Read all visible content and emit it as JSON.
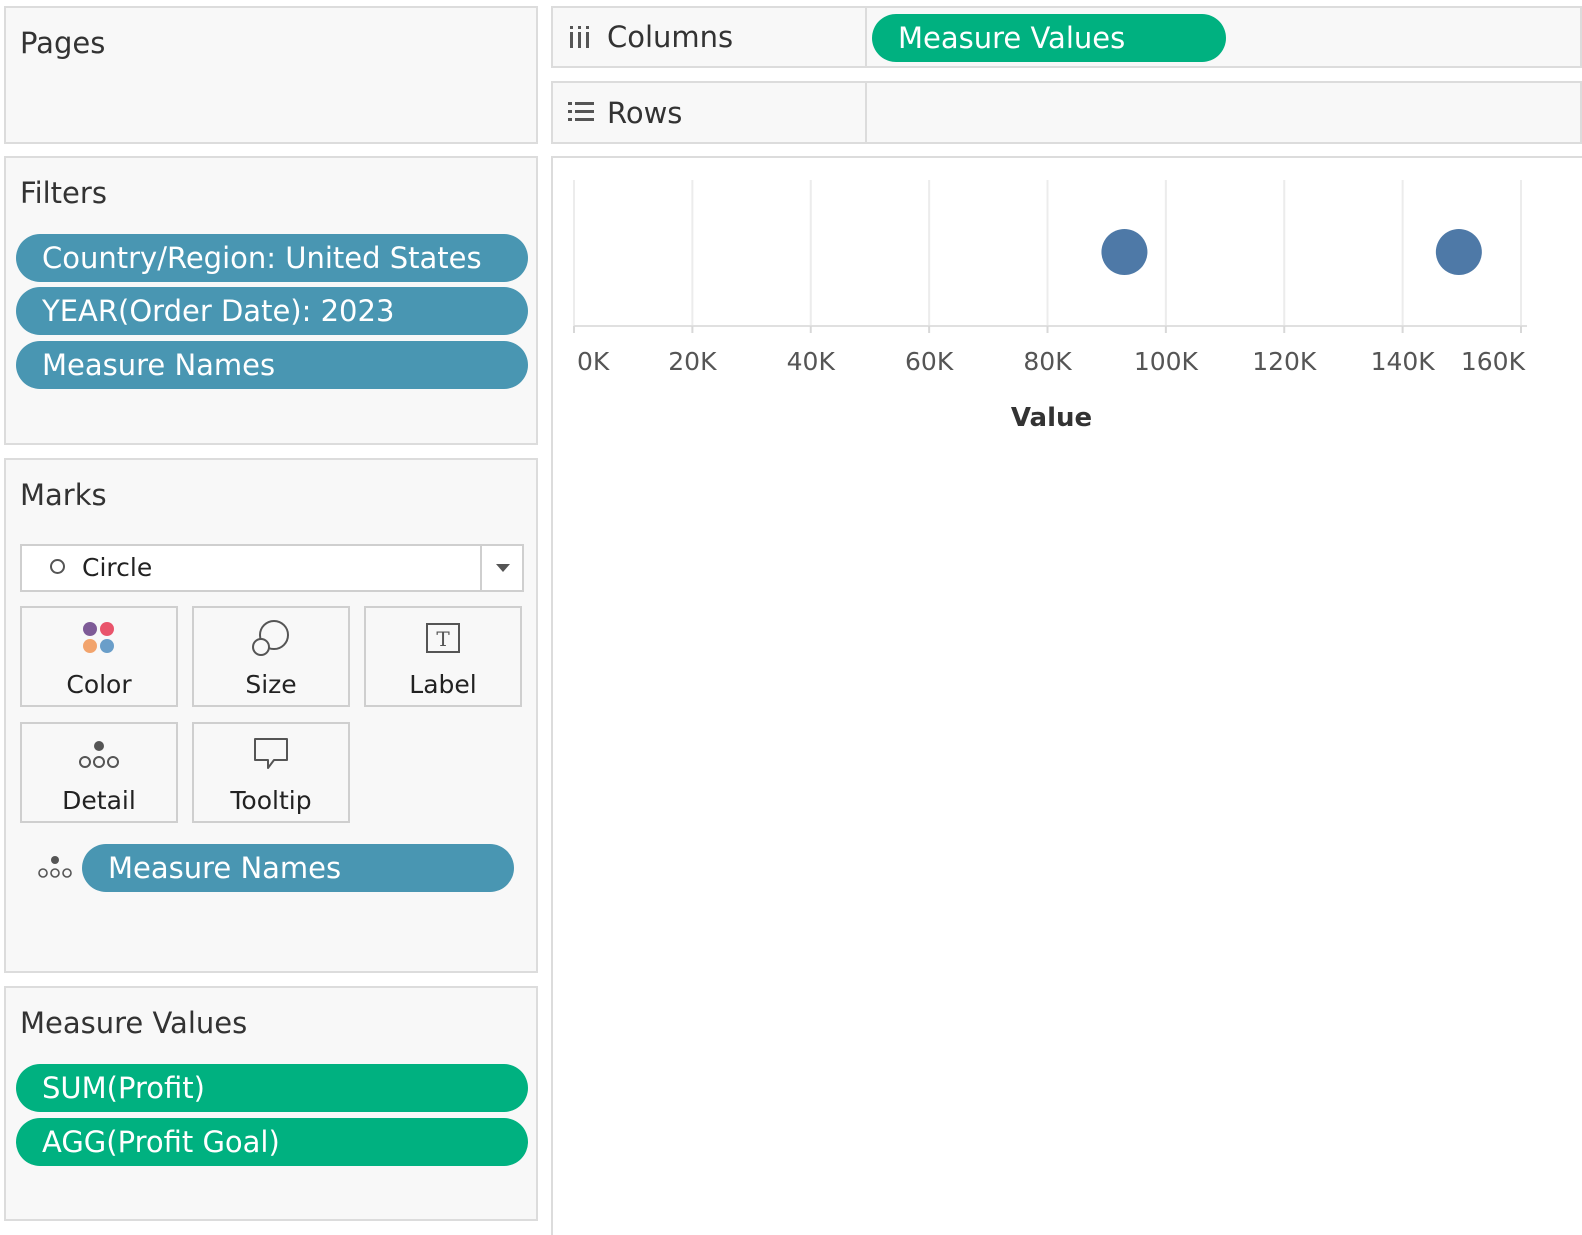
{
  "pages_panel": {
    "title": "Pages"
  },
  "filters_panel": {
    "title": "Filters",
    "pills": [
      {
        "label": "Country/Region: United States"
      },
      {
        "label": "YEAR(Order Date): 2023"
      },
      {
        "label": "Measure Names"
      }
    ]
  },
  "marks_panel": {
    "title": "Marks",
    "mark_type": "Circle",
    "buttons": {
      "color": "Color",
      "size": "Size",
      "label": "Label",
      "detail": "Detail",
      "tooltip": "Tooltip"
    },
    "detail_pill": "Measure Names"
  },
  "measure_values_panel": {
    "title": "Measure Values",
    "pills": [
      {
        "label": "SUM(Profit)"
      },
      {
        "label": "AGG(Profit Goal)"
      }
    ]
  },
  "shelves": {
    "columns": {
      "label": "Columns",
      "pill": "Measure Values"
    },
    "rows": {
      "label": "Rows"
    }
  },
  "colors": {
    "dimension_pill": "#4996b2",
    "measure_pill": "#00b180",
    "mark": "#4e79a7"
  },
  "chart_data": {
    "type": "scatter",
    "xlabel": "Value",
    "xlim": [
      0,
      160000
    ],
    "ticks": [
      {
        "value": 0,
        "label": "0K"
      },
      {
        "value": 20000,
        "label": "20K"
      },
      {
        "value": 40000,
        "label": "40K"
      },
      {
        "value": 60000,
        "label": "60K"
      },
      {
        "value": 80000,
        "label": "80K"
      },
      {
        "value": 100000,
        "label": "100K"
      },
      {
        "value": 120000,
        "label": "120K"
      },
      {
        "value": 140000,
        "label": "140K"
      },
      {
        "value": 160000,
        "label": "160K"
      }
    ],
    "points": [
      {
        "x": 93000
      },
      {
        "x": 149500
      }
    ],
    "grid": true
  }
}
